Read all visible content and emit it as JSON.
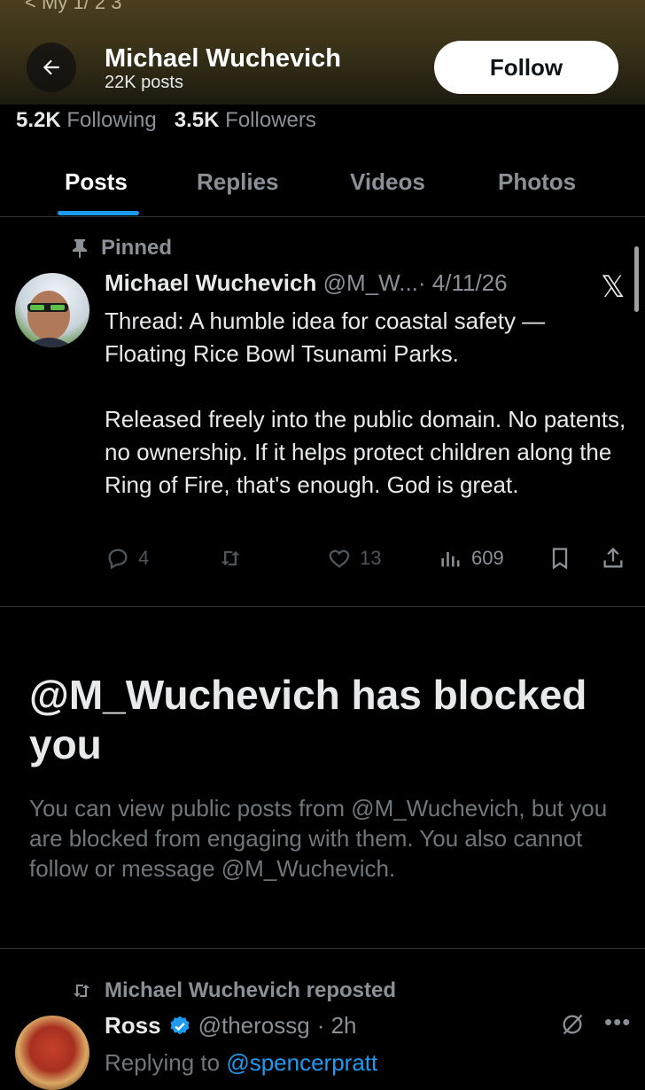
{
  "header": {
    "top_fragment": "< My 1/ 2 3",
    "name": "Michael Wuchevich",
    "posts_count": "22K posts",
    "follow_label": "Follow"
  },
  "stats": {
    "following_count": "5.2K",
    "following_label": "Following",
    "followers_count": "3.5K",
    "followers_label": "Followers"
  },
  "tabs": [
    {
      "label": "Posts",
      "active": true
    },
    {
      "label": "Replies",
      "active": false
    },
    {
      "label": "Videos",
      "active": false
    },
    {
      "label": "Photos",
      "active": false
    }
  ],
  "pinned_post": {
    "pinned_label": "Pinned",
    "author_name": "Michael Wuchevich",
    "handle": "@M_W...",
    "date": "· 4/11/26",
    "text_1": "Thread: A humble idea for coastal safety — Floating Rice Bowl Tsunami Parks.",
    "text_2": "Released freely into the public domain. No patents, no ownership. If it helps protect children along the Ring of Fire, that's enough. God is great.",
    "replies": "4",
    "likes": "13",
    "views": "609"
  },
  "blocked": {
    "title": "@M_Wuchevich has blocked you",
    "description": "You can view public posts from @M_Wuchevich, but you are blocked from engaging with them. You also cannot follow or message @M_Wuchevich."
  },
  "repost": {
    "label": "Michael Wuchevich reposted",
    "author_name": "Ross",
    "handle": "@therossg",
    "time": "· 2h",
    "replying_prefix": "Replying to",
    "replying_to": "@spencerpratt"
  },
  "colors": {
    "accent": "#1d9bf0",
    "background": "#000000",
    "muted_text": "#8b9097"
  }
}
